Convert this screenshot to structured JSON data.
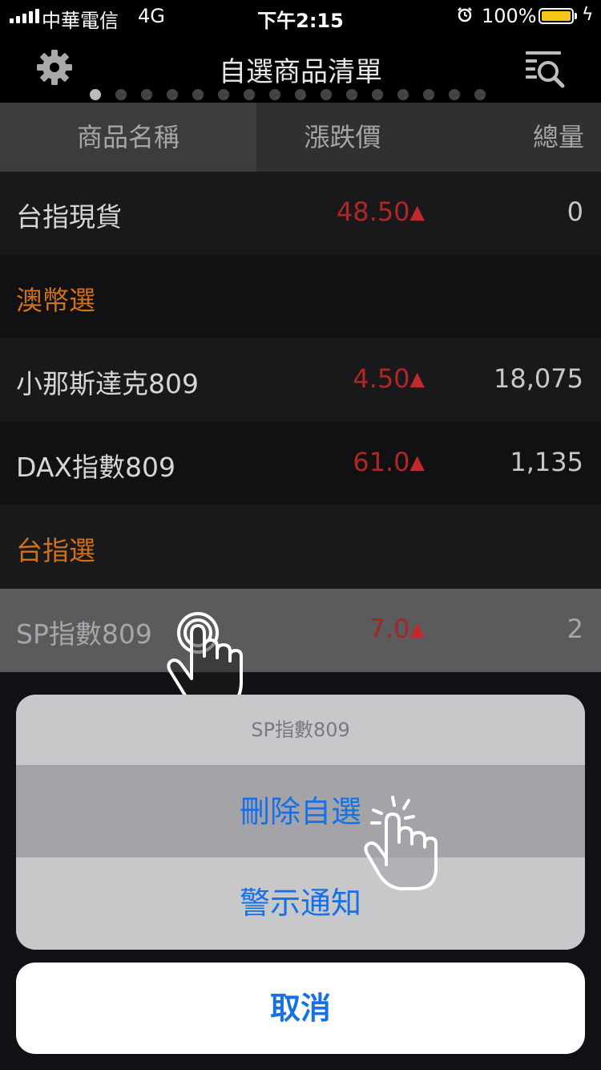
{
  "status_bar": {
    "carrier": "中華電信",
    "network": "4G",
    "time": "下午2:15",
    "battery_percent": "100%",
    "battery_color": "#f5c518"
  },
  "nav": {
    "title": "自選商品清單",
    "left_icon": "gear-icon",
    "right_icon": "list-search-icon"
  },
  "columns": {
    "name": "商品名稱",
    "change": "漲跌價",
    "volume": "總量"
  },
  "rows": [
    {
      "type": "item",
      "name": "台指現貨",
      "change": "48.50",
      "direction": "up",
      "volume": "0"
    },
    {
      "type": "group",
      "name": "澳幣選"
    },
    {
      "type": "item",
      "name": "小那斯達克809",
      "change": "4.50",
      "direction": "up",
      "volume": "18,075"
    },
    {
      "type": "item",
      "name": "DAX指數809",
      "change": "61.0",
      "direction": "up",
      "volume": "1,135"
    },
    {
      "type": "group",
      "name": "台指選"
    },
    {
      "type": "item",
      "name": "SP指數809",
      "change": "7.0",
      "direction": "up",
      "volume": "2",
      "selected": true
    }
  ],
  "action_sheet": {
    "title": "SP指數809",
    "delete_label": "刪除自選",
    "alert_label": "警示通知",
    "cancel_label": "取消"
  },
  "colors": {
    "up": "#b02626",
    "group": "#d0711e",
    "accent": "#1670e6"
  }
}
